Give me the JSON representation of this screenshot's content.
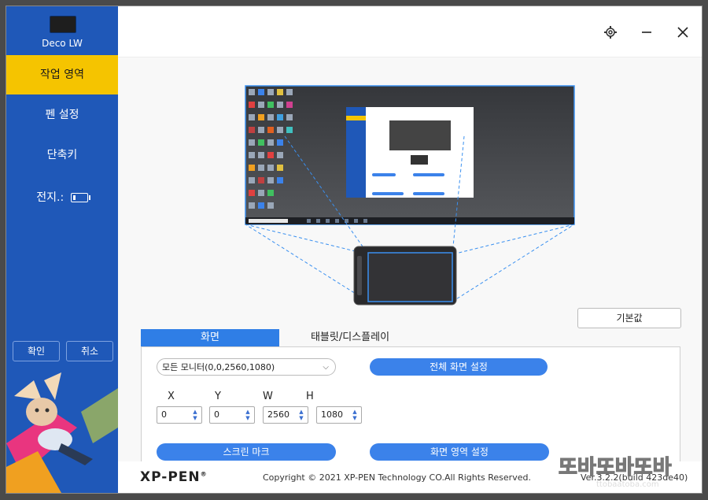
{
  "sidebar": {
    "device_name": "Deco LW",
    "items": [
      {
        "label": "작업 영역",
        "active": true
      },
      {
        "label": "펜 설정",
        "active": false
      },
      {
        "label": "단축키",
        "active": false
      }
    ],
    "battery_label": "전지.:",
    "battery_level": 0.2,
    "ok_label": "확인",
    "cancel_label": "취소"
  },
  "titlebar": {
    "icons": [
      "gear-icon",
      "minimize-icon",
      "close-icon"
    ]
  },
  "main": {
    "default_button": "기본값",
    "tabs": [
      {
        "label": "화면",
        "active": true
      },
      {
        "label": "태블릿/디스플레이",
        "active": false
      }
    ],
    "monitor_select": "모든 모니터(0,0,2560,1080)",
    "fullscreen_button": "전체 화면 설정",
    "coords": {
      "labels": [
        "X",
        "Y",
        "W",
        "H"
      ],
      "values": [
        "0",
        "0",
        "2560",
        "1080"
      ]
    },
    "screen_mark_button": "스크린 마크",
    "screen_area_button": "화면 영역 설정"
  },
  "footer": {
    "logo": "XP-PEN",
    "logo_mark": "®",
    "copyright": "Copyright © 2021 XP-PEN Technology CO.All Rights Reserved.",
    "version": "Ver.3.2.2(build 423de40)"
  },
  "watermark": {
    "text": "또바또바또바",
    "site": "ttobaatoba.com"
  },
  "colors": {
    "sidebar": "#1f58b8",
    "active_nav": "#f5c400",
    "accent": "#3b82ea",
    "tab_active": "#2f7ee6"
  }
}
